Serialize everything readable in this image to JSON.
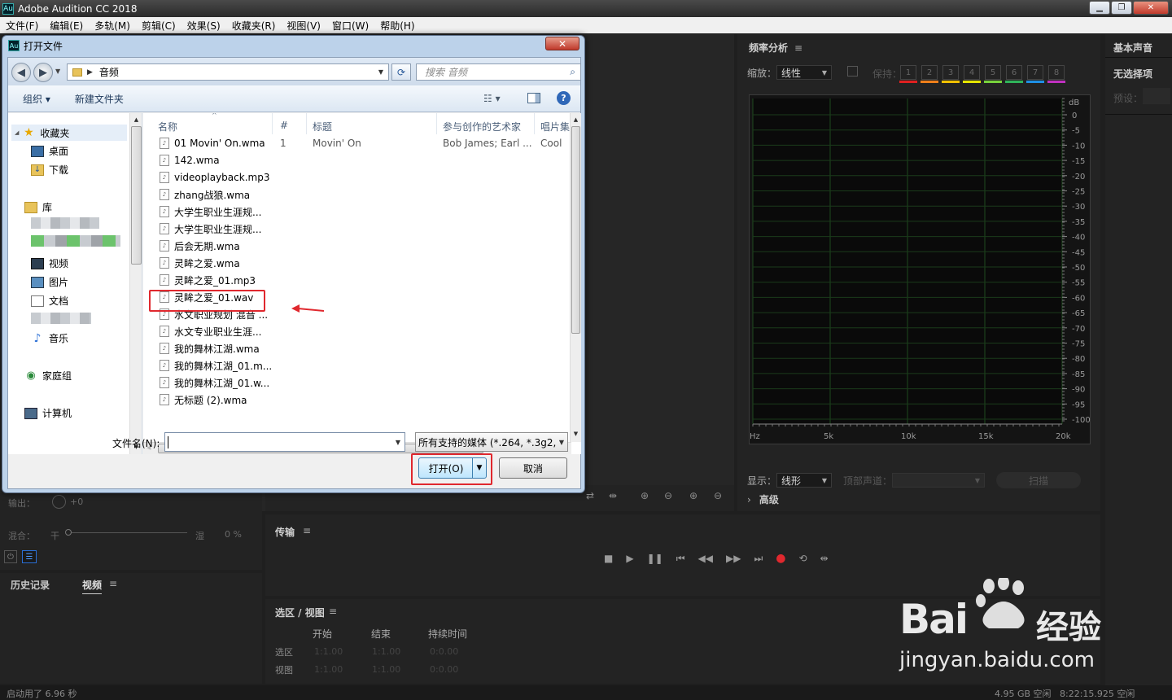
{
  "app": {
    "title": "Adobe Audition CC 2018",
    "badge": "Au"
  },
  "window_controls": {
    "minimize": "▁",
    "restore": "❐",
    "close": "✕"
  },
  "menubar": [
    "文件(F)",
    "编辑(E)",
    "多轨(M)",
    "剪辑(C)",
    "效果(S)",
    "收藏夹(R)",
    "视图(V)",
    "窗口(W)",
    "帮助(H)"
  ],
  "freq_panel": {
    "title": "频率分析",
    "scale_label": "缩放：",
    "scale_value": "线性",
    "hold_label": "保持：",
    "hold_buttons": [
      "1",
      "2",
      "3",
      "4",
      "5",
      "6",
      "7",
      "8"
    ],
    "hold_colors": [
      "#e02020",
      "#ef7f1a",
      "#f0c000",
      "#e6e600",
      "#78d23c",
      "#2fb45a",
      "#1e90e6",
      "#c030c0"
    ],
    "db_unit": "dB",
    "db_ticks": [
      "0",
      "-5",
      "-10",
      "-15",
      "-20",
      "-25",
      "-30",
      "-35",
      "-40",
      "-45",
      "-50",
      "-55",
      "-60",
      "-65",
      "-70",
      "-75",
      "-80",
      "-85",
      "-90",
      "-95",
      "-100"
    ],
    "hz_ticks": [
      "Hz",
      "5k",
      "10k",
      "15k",
      "20k"
    ],
    "display_label": "显示：",
    "display_value": "线形",
    "top_channel_label": "顶部声道：",
    "scan_button": "扫描",
    "advanced_label": "高级"
  },
  "right_panel": {
    "title": "基本声音",
    "no_selection": "无选择项",
    "preset_label": "预设："
  },
  "transport": {
    "title": "传输"
  },
  "selection": {
    "title": "选区 / 视图",
    "columns": [
      "开始",
      "结束",
      "持续时间"
    ],
    "rows": [
      {
        "label": "选区",
        "start": "1:1.00",
        "end": "1:1.00",
        "duration": "0:0.00"
      },
      {
        "label": "视图",
        "start": "1:1.00",
        "end": "1:1.00",
        "duration": "0:0.00"
      }
    ]
  },
  "mixer": {
    "output_label": "输出：",
    "output_value": "+0",
    "mix_label": "混合：",
    "dry_label": "干",
    "wet_label": "湿",
    "wet_value": "0 %"
  },
  "history_tabs": [
    "历史记录",
    "视频"
  ],
  "status": {
    "left": "启动用了 6.96 秒",
    "disk": "4.95 GB 空闲",
    "time": "8:22:15.925 空闲"
  },
  "dialog": {
    "title": "打开文件",
    "close": "✕",
    "address": "音频",
    "search_placeholder": "搜索 音频",
    "toolbar": {
      "organize": "组织 ▾",
      "new_folder": "新建文件夹"
    },
    "nav": {
      "favorites": "收藏夹",
      "desktop": "桌面",
      "downloads": "下载",
      "library": "库",
      "videos": "视频",
      "pictures": "图片",
      "documents": "文档",
      "music": "音乐",
      "homegroup": "家庭组",
      "computer": "计算机"
    },
    "columns": [
      "名称",
      "#",
      "标题",
      "参与创作的艺术家",
      "唱片集"
    ],
    "files": [
      {
        "name": "01 Movin' On.wma",
        "num": "1",
        "title": "Movin' On",
        "artist": "Bob James; Earl ...",
        "album": "Cool"
      },
      {
        "name": "142.wma"
      },
      {
        "name": "videoplayback.mp3"
      },
      {
        "name": "zhang战狼.wma"
      },
      {
        "name": "大学生职业生涯规..."
      },
      {
        "name": "大学生职业生涯规..."
      },
      {
        "name": "后会无期.wma"
      },
      {
        "name": "灵眸之爱.wma"
      },
      {
        "name": "灵眸之爱_01.mp3"
      },
      {
        "name": "灵眸之爱_01.wav"
      },
      {
        "name": "水文职业规划 混音 ..."
      },
      {
        "name": "水文专业职业生涯..."
      },
      {
        "name": "我的舞林江湖.wma"
      },
      {
        "name": "我的舞林江湖_01.m..."
      },
      {
        "name": "我的舞林江湖_01.w..."
      },
      {
        "name": "无标题 (2).wma"
      }
    ],
    "filename_label": "文件名(N):",
    "filename_value": "",
    "filetype": "所有支持的媒体 (*.264, *.3g2,",
    "open_button": "打开(O)",
    "cancel_button": "取消"
  },
  "watermark": {
    "brand": "Bai",
    "brand2": "经验",
    "url": "jingyan.baidu.com"
  }
}
